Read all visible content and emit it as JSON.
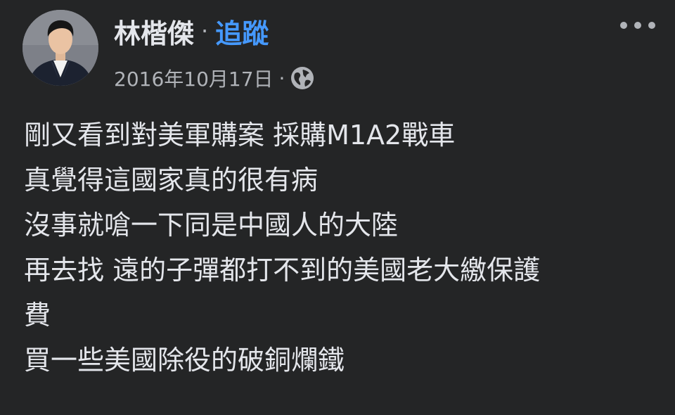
{
  "post": {
    "author": {
      "name": "林楷傑",
      "separator": "·",
      "follow_label": "追蹤"
    },
    "meta": {
      "date": "2016年10月17日",
      "separator": "·",
      "audience_icon": "globe-icon"
    },
    "more_icon": "more-options-icon",
    "body_lines": [
      "剛又看到對美軍購案 採購M1A2戰車",
      "真覺得這國家真的很有病",
      "沒事就嗆一下同是中國人的大陸",
      "再去找 遠的子彈都打不到的美國老大繳保護",
      "費",
      "買一些美國除役的破銅爛鐵"
    ]
  },
  "colors": {
    "background": "#242526",
    "primary_text": "#e4e6eb",
    "secondary_text": "#b0b3b8",
    "link": "#4599ff"
  }
}
